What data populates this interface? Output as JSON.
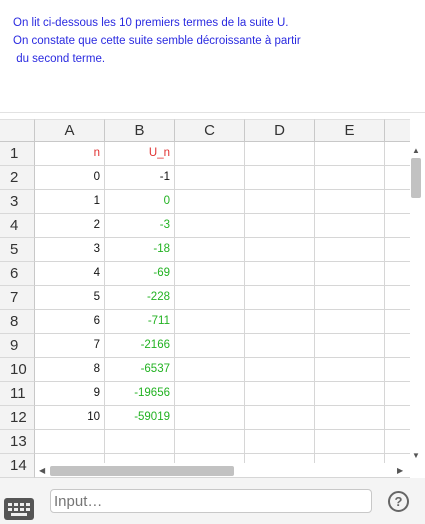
{
  "note": {
    "lines": [
      "On lit ci-dessous les 10 premiers termes de la suite U.",
      "On constate que cette suite semble décroissante à partir",
      " du second terme."
    ]
  },
  "spreadsheet": {
    "columns": [
      "A",
      "B",
      "C",
      "D",
      "E",
      ""
    ],
    "row_numbers": [
      "1",
      "2",
      "3",
      "4",
      "5",
      "6",
      "7",
      "8",
      "9",
      "10",
      "11",
      "12",
      "13",
      "14"
    ],
    "rows": [
      [
        "n",
        "U_n"
      ],
      [
        "0",
        "-1"
      ],
      [
        "1",
        "0"
      ],
      [
        "2",
        "-3"
      ],
      [
        "3",
        "-18"
      ],
      [
        "4",
        "-69"
      ],
      [
        "5",
        "-228"
      ],
      [
        "6",
        "-711"
      ],
      [
        "7",
        "-2166"
      ],
      [
        "8",
        "-6537"
      ],
      [
        "9",
        "-19656"
      ],
      [
        "10",
        "-59019"
      ]
    ],
    "colors": {
      "header": "#e03030",
      "n_values": "#111111",
      "u_values": "#22b222",
      "first_u": "#111111"
    }
  },
  "input_bar": {
    "placeholder": "Input…",
    "help_label": "?"
  },
  "icons": {
    "keyboard": "keyboard-icon",
    "help": "help-icon",
    "scroll_up": "arrow-up-icon",
    "scroll_down": "arrow-down-icon",
    "scroll_left": "arrow-left-icon",
    "scroll_right": "arrow-right-icon"
  }
}
